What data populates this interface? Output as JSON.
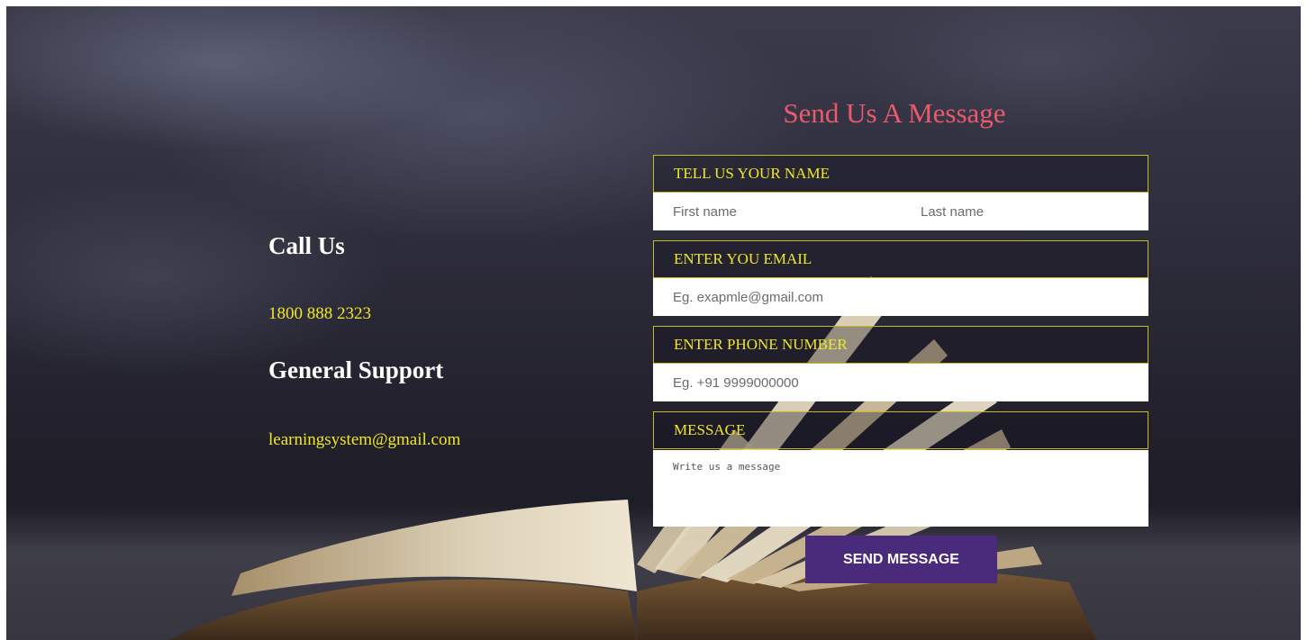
{
  "contact": {
    "call_heading": "Call Us",
    "phone": "1800 888 2323",
    "support_heading": "General Support",
    "email": "learningsystem@gmail.com"
  },
  "form": {
    "title": "Send Us A Message",
    "name_label": "TELL US YOUR NAME",
    "first_name_placeholder": "First name",
    "last_name_placeholder": "Last name",
    "email_label": "ENTER YOU EMAIL",
    "email_placeholder": "Eg. exapmle@gmail.com",
    "phone_label": "ENTER PHONE NUMBER",
    "phone_placeholder": "Eg. +91 9999000000",
    "message_label": "MESSAGE",
    "message_placeholder": "Write us a message",
    "submit_label": "SEND MESSAGE"
  },
  "colors": {
    "title": "#ea5a6c",
    "accent_yellow": "#f0e62c",
    "button": "#4a2a7a"
  }
}
